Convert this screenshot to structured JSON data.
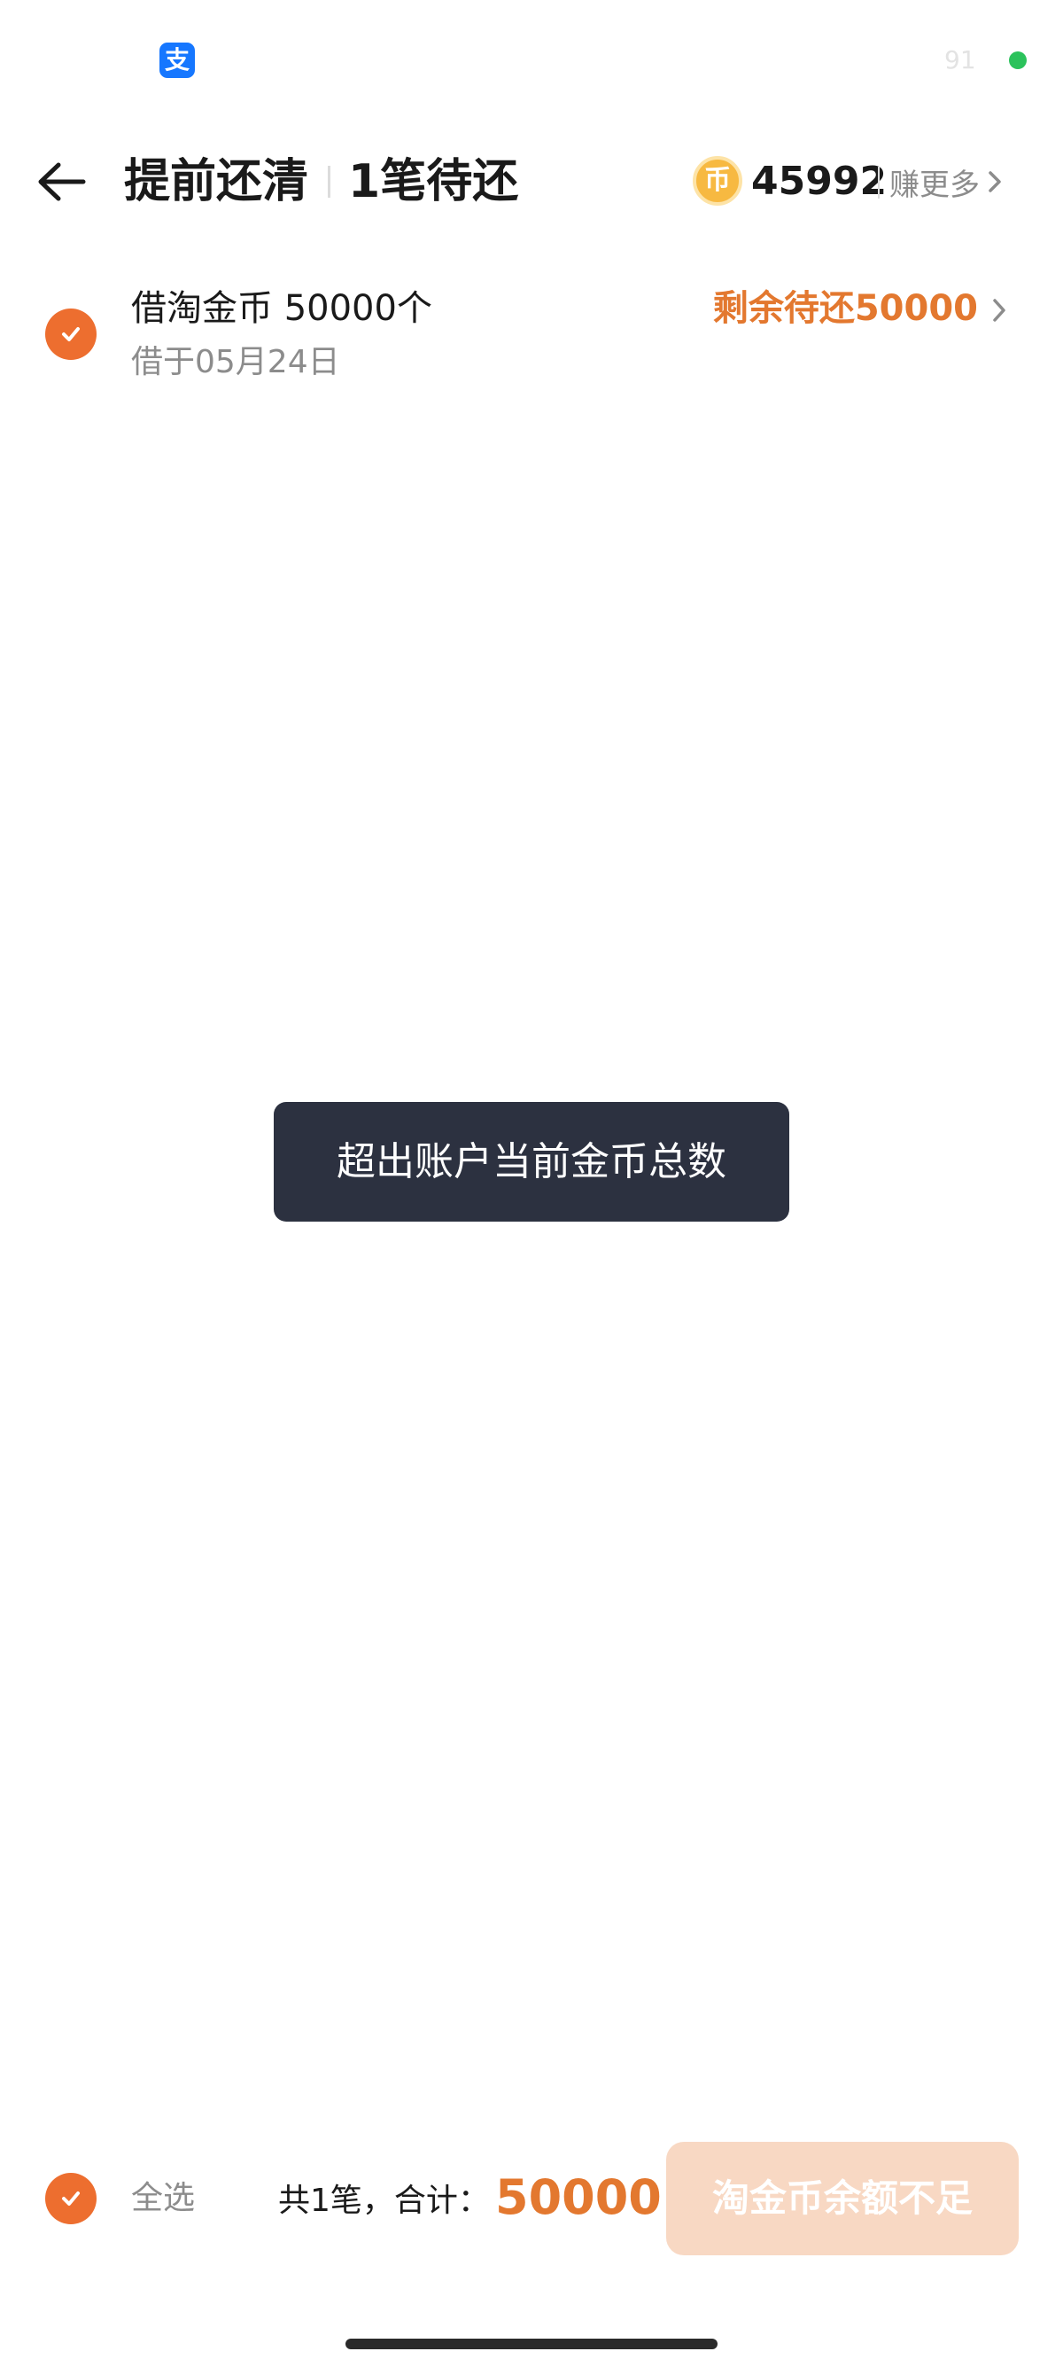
{
  "status_bar": {
    "app_icon_glyph": "支",
    "status_text": "91",
    "indicator_color": "#2bc25b"
  },
  "header": {
    "title": "提前还清",
    "subtitle": "1笔待还",
    "coin_balance": "45992",
    "coin_glyph": "币",
    "earn_more_label": "赚更多"
  },
  "loans": [
    {
      "name": "借淘金币 50000个",
      "date": "借于05月24日",
      "remaining": "剩余待还50000",
      "checked": true
    }
  ],
  "toast": {
    "message": "超出账户当前金币总数"
  },
  "footer": {
    "select_all_label": "全选",
    "total_label": "共1笔，合计：",
    "total_value": "50000",
    "action_button_label": "淘金币余额不足"
  },
  "colors": {
    "accent": "#ed6e2f",
    "amount": "#e3782f",
    "button_disabled": "#f8d8c3",
    "toast_bg": "#2c3140"
  },
  "icons": [
    "back-arrow-icon",
    "coin-icon",
    "chevron-right-icon",
    "checkmark-icon"
  ]
}
